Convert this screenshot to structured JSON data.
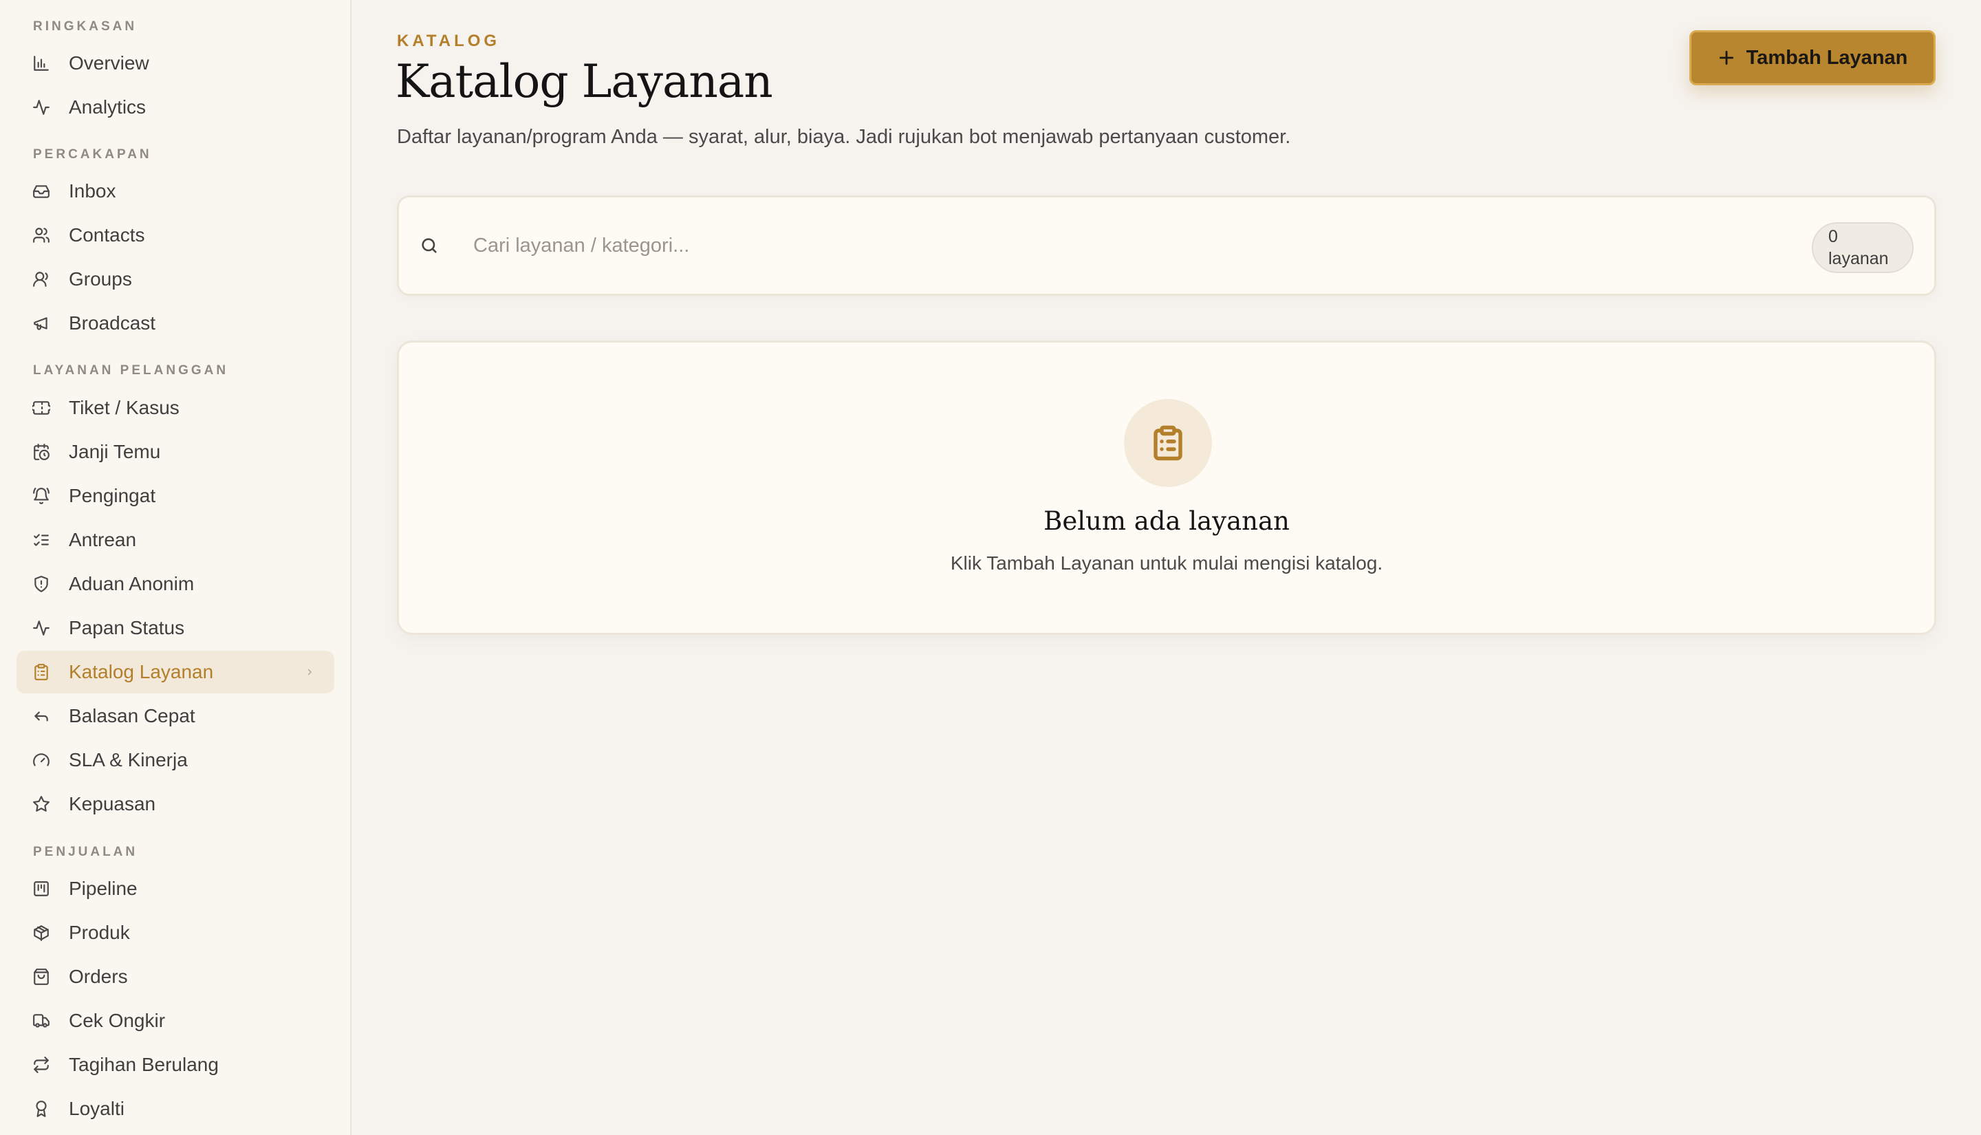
{
  "sidebar": {
    "sections": {
      "ringkasan": "RINGKASAN",
      "percakapan": "PERCAKAPAN",
      "layanan_pelanggan": "LAYANAN PELANGGAN",
      "penjualan": "PENJUALAN"
    },
    "items": {
      "overview": "Overview",
      "analytics": "Analytics",
      "inbox": "Inbox",
      "contacts": "Contacts",
      "groups": "Groups",
      "broadcast": "Broadcast",
      "tiket": "Tiket / Kasus",
      "janji": "Janji Temu",
      "pengingat": "Pengingat",
      "antrean": "Antrean",
      "aduan": "Aduan Anonim",
      "papan": "Papan Status",
      "katalog": "Katalog Layanan",
      "balasan": "Balasan Cepat",
      "sla": "SLA & Kinerja",
      "kepuasan": "Kepuasan",
      "pipeline": "Pipeline",
      "produk": "Produk",
      "orders": "Orders",
      "ongkir": "Cek Ongkir",
      "tagihan": "Tagihan Berulang",
      "loyalti": "Loyalti"
    },
    "active_item": "Katalog Layanan"
  },
  "header": {
    "eyebrow": "KATALOG",
    "title": "Katalog Layanan",
    "subtitle": "Daftar layanan/program Anda — syarat, alur, biaya. Jadi rujukan bot menjawab pertanyaan customer.",
    "add_button": "Tambah Layanan"
  },
  "search": {
    "placeholder": "Cari layanan / kategori...",
    "value": "",
    "count_number": "0",
    "count_unit": "layanan"
  },
  "empty_state": {
    "title": "Belum ada layanan",
    "text": "Klik Tambah Layanan untuk mulai mengisi katalog."
  },
  "colors": {
    "accent": "#b8862f",
    "accent_text": "#b37f2a",
    "background": "#f6f3ee",
    "sidebar_bg": "#faf7f1",
    "card_bg": "#fefbf4",
    "active_item_bg": "#f3e9da"
  }
}
